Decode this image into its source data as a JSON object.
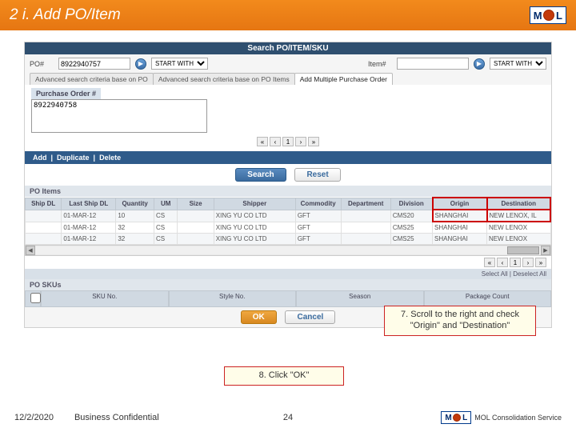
{
  "slide": {
    "title": "2 i. Add PO/Item",
    "logo": {
      "m": "M",
      "l": "L"
    }
  },
  "app": {
    "searchHeader": "Search PO/ITEM/SKU",
    "poLabel": "PO#",
    "poValue": "8922940757",
    "startWith1": "START WITH",
    "itemLabel": "Item#",
    "startWith2": "START WITH",
    "tabs": {
      "t1": "Advanced search criteria base on PO",
      "t2": "Advanced search criteria base on PO Items",
      "t3": "Add Multiple Purchase Order"
    },
    "poNumLabel": "Purchase Order #",
    "taValue": "8922940758",
    "pager": {
      "p1": "1"
    },
    "actions": {
      "add": "Add",
      "dup": "Duplicate",
      "del": "Delete"
    },
    "bigBtns": {
      "search": "Search",
      "reset": "Reset"
    },
    "poItemsLabel": "PO Items",
    "headers": {
      "h1": "Ship DL",
      "h2": "Last Ship DL",
      "h3": "Quantity",
      "h4": "UM",
      "h5": "Size",
      "h6": "Shipper",
      "h7": "Commodity",
      "h8": "Department",
      "h9": "Division",
      "h10": "Origin",
      "h11": "Destination"
    },
    "rows": [
      {
        "c1": "",
        "c2": "01-MAR-12",
        "c3": "10",
        "c4": "CS",
        "c5": "",
        "c6": "XING YU CO LTD",
        "c7": "GFT",
        "c8": "",
        "c9": "CMS20",
        "c10": "SHANGHAI",
        "c11": "NEW LENOX, IL"
      },
      {
        "c1": "",
        "c2": "01-MAR-12",
        "c3": "32",
        "c4": "CS",
        "c5": "",
        "c6": "XING YU CO LTD",
        "c7": "GFT",
        "c8": "",
        "c9": "CMS25",
        "c10": "SHANGHAI",
        "c11": "NEW LENOX"
      },
      {
        "c1": "",
        "c2": "01-MAR-12",
        "c3": "32",
        "c4": "CS",
        "c5": "",
        "c6": "XING YU CO LTD",
        "c7": "GFT",
        "c8": "",
        "c9": "CMS25",
        "c10": "SHANGHAI",
        "c11": "NEW LENOX"
      }
    ],
    "selectAll": "Select All | Deselect All",
    "poSkusLabel": "PO SKUs",
    "skuHeaders": {
      "s1": "SKU No.",
      "s2": "Style No.",
      "s3": "Season",
      "s4": "Package Count"
    },
    "okCancel": {
      "ok": "OK",
      "cancel": "Cancel"
    }
  },
  "callouts": {
    "c1a": "7. Scroll to the right and check",
    "c1b": "\"Origin\" and \"Destination\"",
    "c2": "8. Click \"OK\""
  },
  "footer": {
    "date": "12/2/2020",
    "conf": "Business Confidential",
    "page": "24",
    "service": "MOL Consolidation Service"
  }
}
